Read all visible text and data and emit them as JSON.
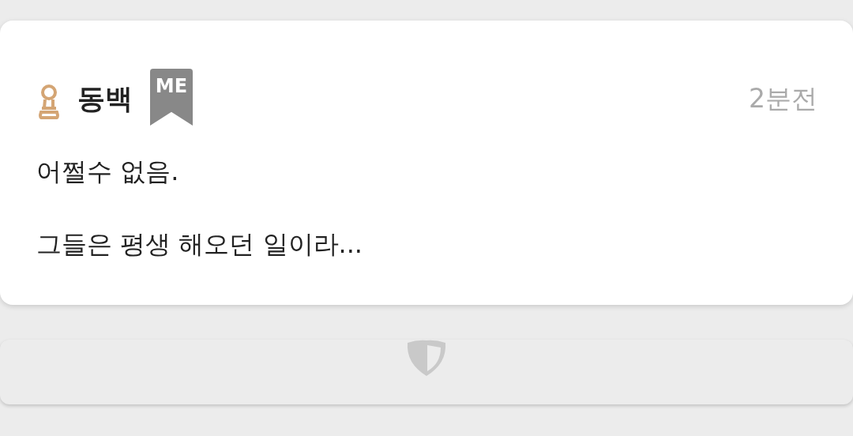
{
  "post": {
    "author": "동백",
    "badge": "ME",
    "time": "2분전",
    "lines": [
      "어쩔수 없음.",
      "그들은 평생 해오던 일이라..."
    ]
  }
}
